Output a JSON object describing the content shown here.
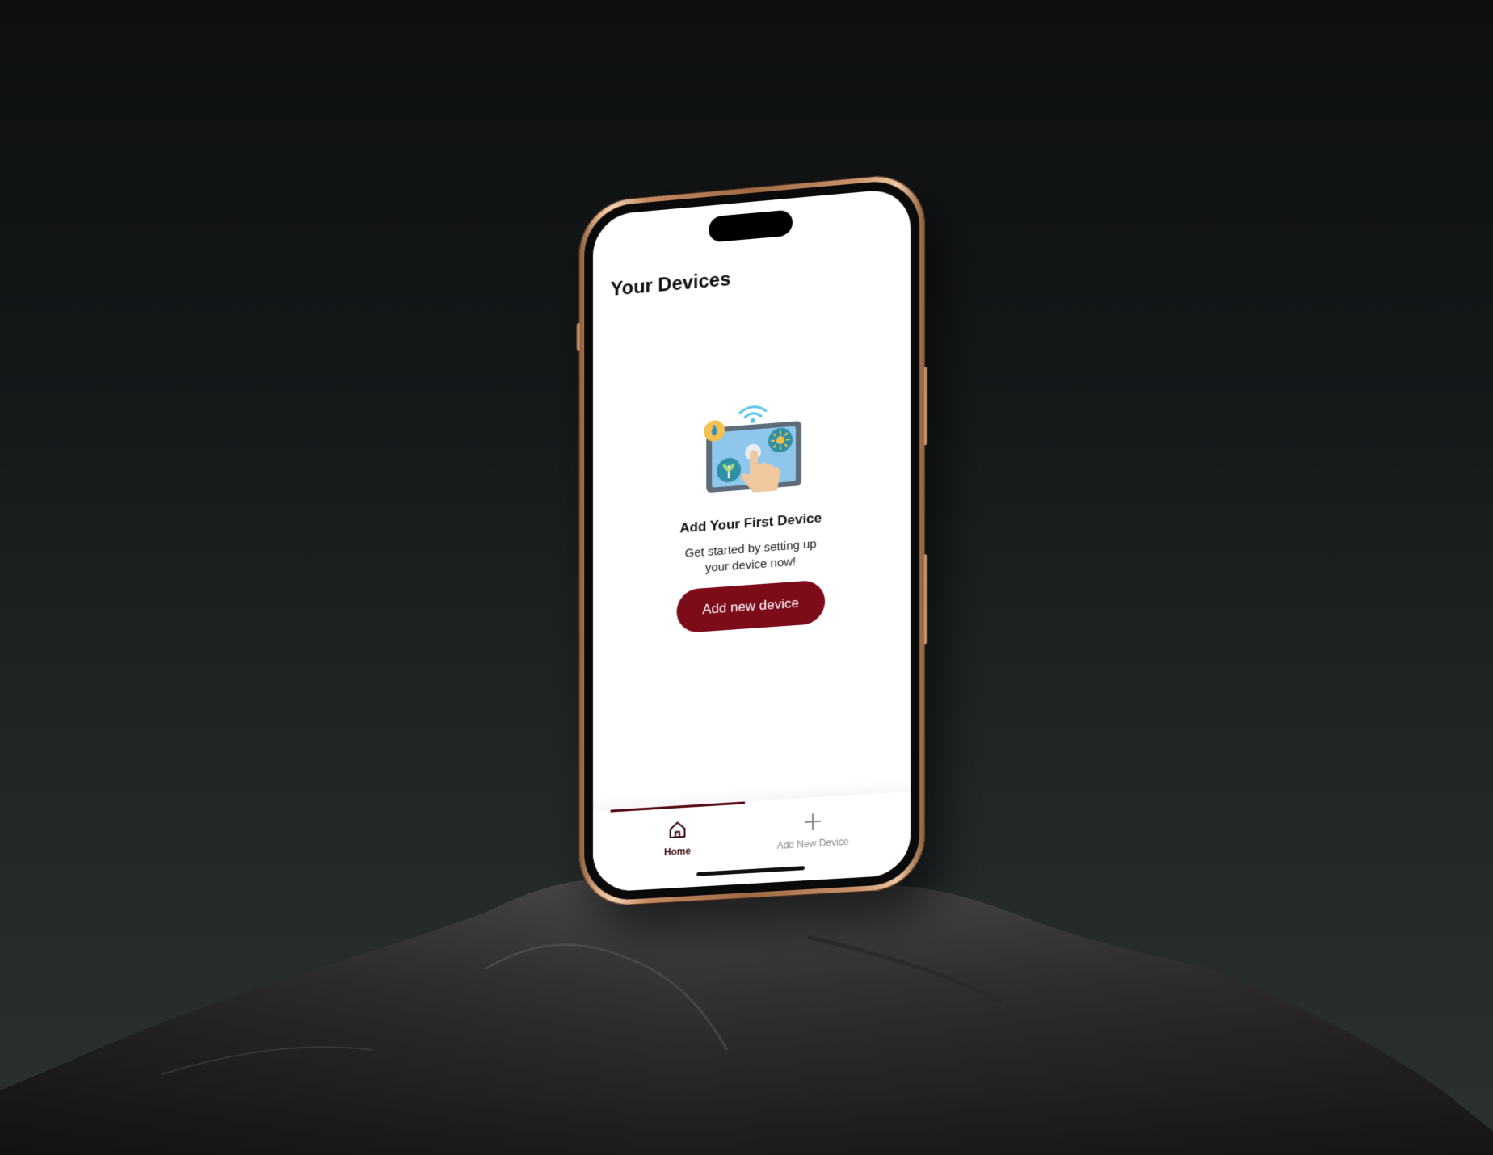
{
  "screen": {
    "title": "Your Devices",
    "empty_state": {
      "heading": "Add Your First Device",
      "subtitle_line1": "Get started by setting up",
      "subtitle_line2": "your device now!",
      "button_label": "Add new device"
    }
  },
  "tab_bar": {
    "tabs": [
      {
        "label": "Home",
        "icon": "home-icon",
        "active": true
      },
      {
        "label": "Add New Device",
        "icon": "plus-icon",
        "active": false
      }
    ]
  },
  "colors": {
    "accent": "#7d0c1b",
    "active_tab": "#3a0810",
    "phone_frame": "#c9926a"
  }
}
